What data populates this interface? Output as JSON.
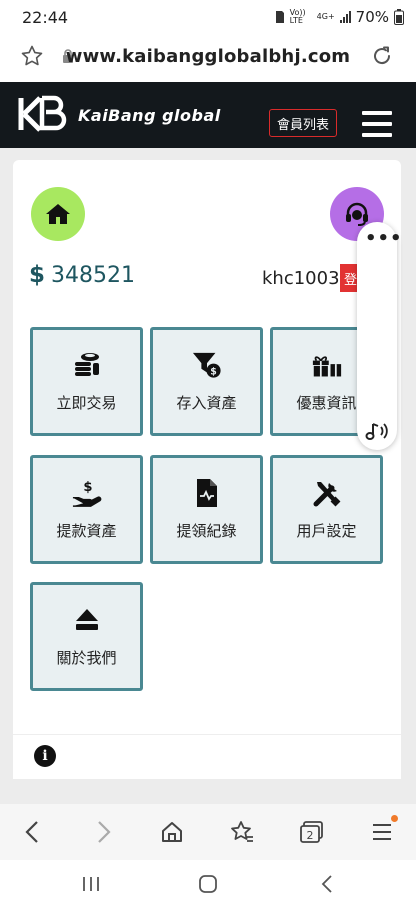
{
  "status_bar": {
    "time": "22:44",
    "network_top": "Vo)) LTE",
    "network_type": "4G+",
    "battery": "70%"
  },
  "browser": {
    "url": "www.kaibangglobalbhj.com"
  },
  "header": {
    "brand": "KaiBang  global",
    "member_list_label": "會員列表"
  },
  "account": {
    "currency_symbol": "$",
    "balance": "348521",
    "username": "khc1003",
    "logout_label": "登"
  },
  "tiles": [
    {
      "label": "立即交易",
      "icon": "coins-icon"
    },
    {
      "label": "存入資產",
      "icon": "funnel-dollar-icon"
    },
    {
      "label": "優惠資訊",
      "icon": "gift-icon"
    },
    {
      "label": "提款資產",
      "icon": "hand-dollar-icon"
    },
    {
      "label": "提領紀錄",
      "icon": "file-chart-icon"
    },
    {
      "label": "用戶設定",
      "icon": "tools-icon"
    },
    {
      "label": "關於我們",
      "icon": "eject-icon"
    }
  ],
  "side_widget": {
    "menu_symbol": "•••"
  },
  "info_symbol": "i",
  "colors": {
    "header_bg": "#13181c",
    "tile_border": "#4a8892",
    "home_button": "#a8e860",
    "support_button": "#b56ee6",
    "logout_red": "#e23232"
  }
}
